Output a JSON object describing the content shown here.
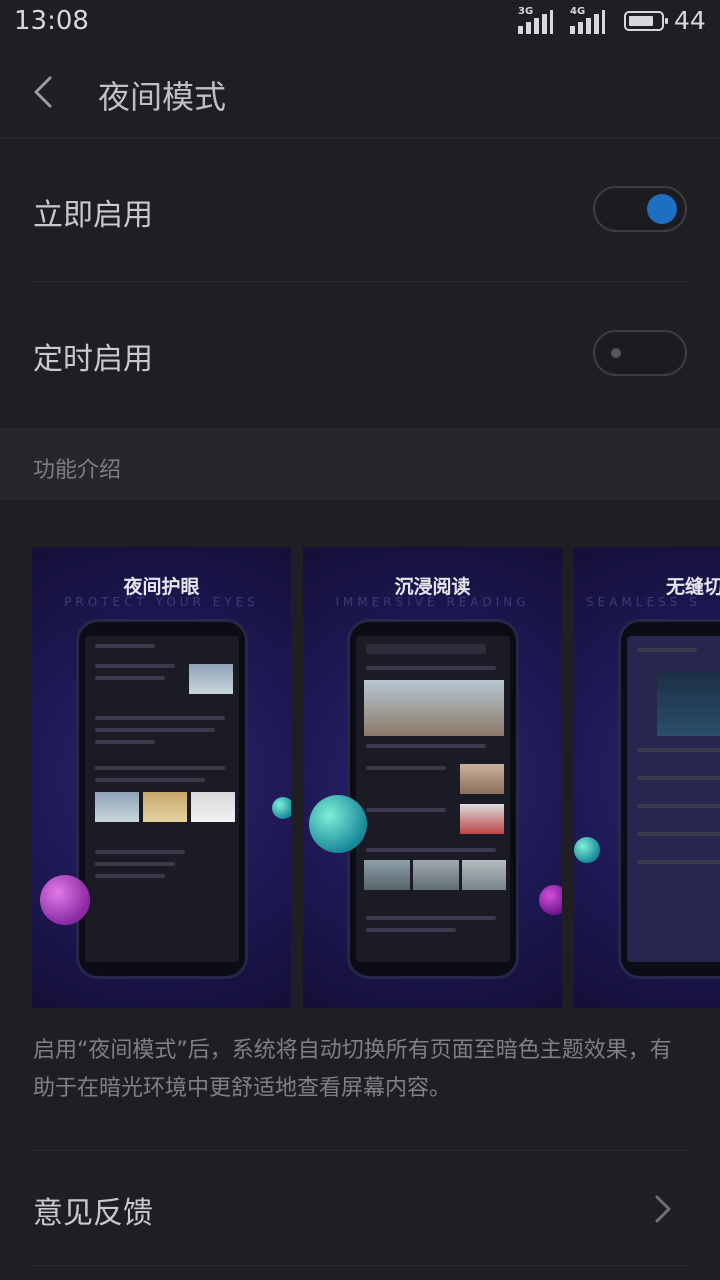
{
  "status_bar": {
    "time": "13:08",
    "network_1": "3G",
    "network_2": "4G",
    "battery": "44"
  },
  "header": {
    "title": "夜间模式"
  },
  "settings": {
    "enable_now": {
      "label": "立即启用",
      "enabled": true
    },
    "scheduled": {
      "label": "定时启用",
      "enabled": false
    }
  },
  "section": {
    "title": "功能介绍"
  },
  "cards": [
    {
      "title": "夜间护眼",
      "subtitle": "PROTECT YOUR EYES"
    },
    {
      "title": "沉浸阅读",
      "subtitle": "IMMERSIVE READING"
    },
    {
      "title": "无缝切",
      "subtitle": "SEAMLESS S"
    }
  ],
  "description": "启用“夜间模式”后，系统将自动切换所有页面至暗色主题效果，有助于在暗光环境中更舒适地查看屏幕内容。",
  "feedback": {
    "label": "意见反馈"
  },
  "colors": {
    "accent": "#1d6fc4",
    "background": "#1f1f23"
  }
}
